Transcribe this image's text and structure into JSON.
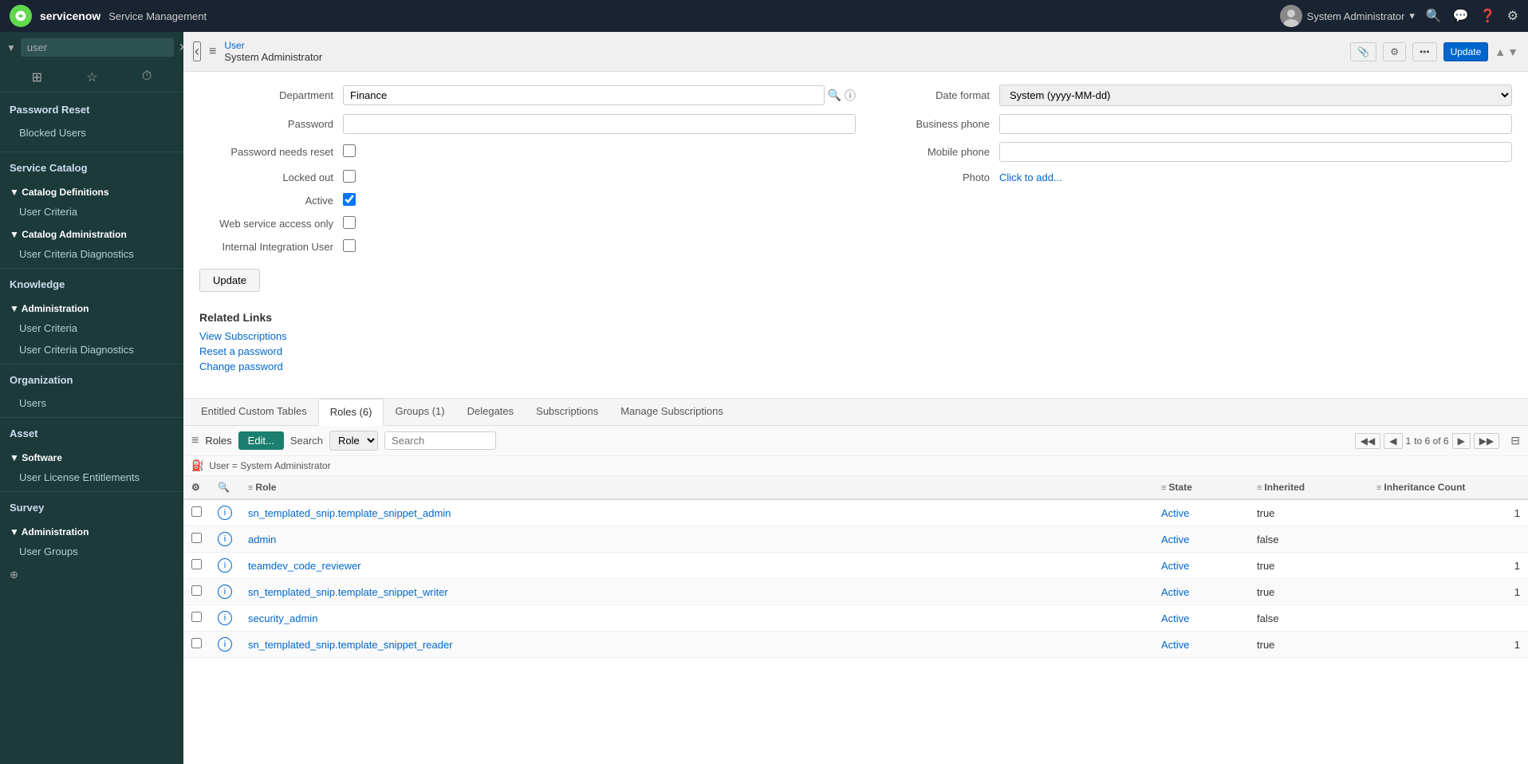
{
  "topnav": {
    "logo_text": "servicenow",
    "app_title": "Service Management",
    "user_name": "System Administrator",
    "nav_icons": [
      "search",
      "chat",
      "help",
      "settings"
    ]
  },
  "sidebar": {
    "search_placeholder": "user",
    "icons": [
      "grid",
      "star",
      "history"
    ],
    "sections": [
      {
        "label": "Password Reset",
        "type": "group",
        "items": [
          {
            "label": "Blocked Users"
          }
        ]
      },
      {
        "label": "Service Catalog",
        "type": "header"
      },
      {
        "label": "▼ Catalog Definitions",
        "type": "subgroup",
        "items": [
          {
            "label": "User Criteria"
          }
        ]
      },
      {
        "label": "▼ Catalog Administration",
        "type": "subgroup",
        "items": [
          {
            "label": "User Criteria Diagnostics"
          }
        ]
      },
      {
        "label": "Knowledge",
        "type": "header"
      },
      {
        "label": "▼ Administration",
        "type": "subgroup",
        "items": [
          {
            "label": "User Criteria"
          },
          {
            "label": "User Criteria Diagnostics"
          }
        ]
      },
      {
        "label": "Organization",
        "type": "header"
      },
      {
        "label": "Users",
        "type": "item"
      },
      {
        "label": "Asset",
        "type": "header"
      },
      {
        "label": "▼ Software",
        "type": "subgroup",
        "items": [
          {
            "label": "User License Entitlements"
          }
        ]
      },
      {
        "label": "Survey",
        "type": "header"
      },
      {
        "label": "▼ Administration",
        "type": "subgroup",
        "items": [
          {
            "label": "User Groups"
          }
        ]
      }
    ]
  },
  "subheader": {
    "breadcrumb": "User",
    "title": "System Administrator",
    "update_label": "Update",
    "attach_icon": "paperclip",
    "settings_icon": "sliders",
    "more_icon": "ellipsis"
  },
  "form": {
    "department_label": "Department",
    "department_value": "Finance",
    "date_format_label": "Date format",
    "date_format_value": "System (yyyy-MM-dd)",
    "password_label": "Password",
    "business_phone_label": "Business phone",
    "password_needs_reset_label": "Password needs reset",
    "mobile_phone_label": "Mobile phone",
    "locked_out_label": "Locked out",
    "photo_label": "Photo",
    "photo_link": "Click to add...",
    "active_label": "Active",
    "active_checked": true,
    "web_service_label": "Web service access only",
    "internal_integration_label": "Internal Integration User",
    "update_btn": "Update"
  },
  "related_links": {
    "title": "Related Links",
    "links": [
      "View Subscriptions",
      "Reset a password",
      "Change password"
    ]
  },
  "tabs": {
    "items": [
      {
        "label": "Entitled Custom Tables",
        "active": false
      },
      {
        "label": "Roles (6)",
        "active": true
      },
      {
        "label": "Groups (1)",
        "active": false
      },
      {
        "label": "Delegates",
        "active": false
      },
      {
        "label": "Subscriptions",
        "active": false
      },
      {
        "label": "Manage Subscriptions",
        "active": false
      }
    ]
  },
  "roles_table": {
    "toolbar": {
      "menu_label": "Roles",
      "edit_label": "Edit...",
      "search_label": "Search",
      "role_option": "Role",
      "search_placeholder": "Search"
    },
    "pagination": {
      "first": "◀◀",
      "prev": "◀",
      "current": "1",
      "total": "to 6 of 6",
      "next": "▶",
      "last": "▶▶"
    },
    "filter": "User = System Administrator",
    "columns": [
      {
        "label": "Role"
      },
      {
        "label": "State"
      },
      {
        "label": "Inherited"
      },
      {
        "label": "Inheritance Count"
      }
    ],
    "rows": [
      {
        "role": "sn_templated_snip.template_snippet_admin",
        "state": "Active",
        "inherited": "true",
        "count": "1"
      },
      {
        "role": "admin",
        "state": "Active",
        "inherited": "false",
        "count": ""
      },
      {
        "role": "teamdev_code_reviewer",
        "state": "Active",
        "inherited": "true",
        "count": "1"
      },
      {
        "role": "sn_templated_snip.template_snippet_writer",
        "state": "Active",
        "inherited": "true",
        "count": "1"
      },
      {
        "role": "security_admin",
        "state": "Active",
        "inherited": "false",
        "count": ""
      },
      {
        "role": "sn_templated_snip.template_snippet_reader",
        "state": "Active",
        "inherited": "true",
        "count": "1"
      }
    ]
  }
}
